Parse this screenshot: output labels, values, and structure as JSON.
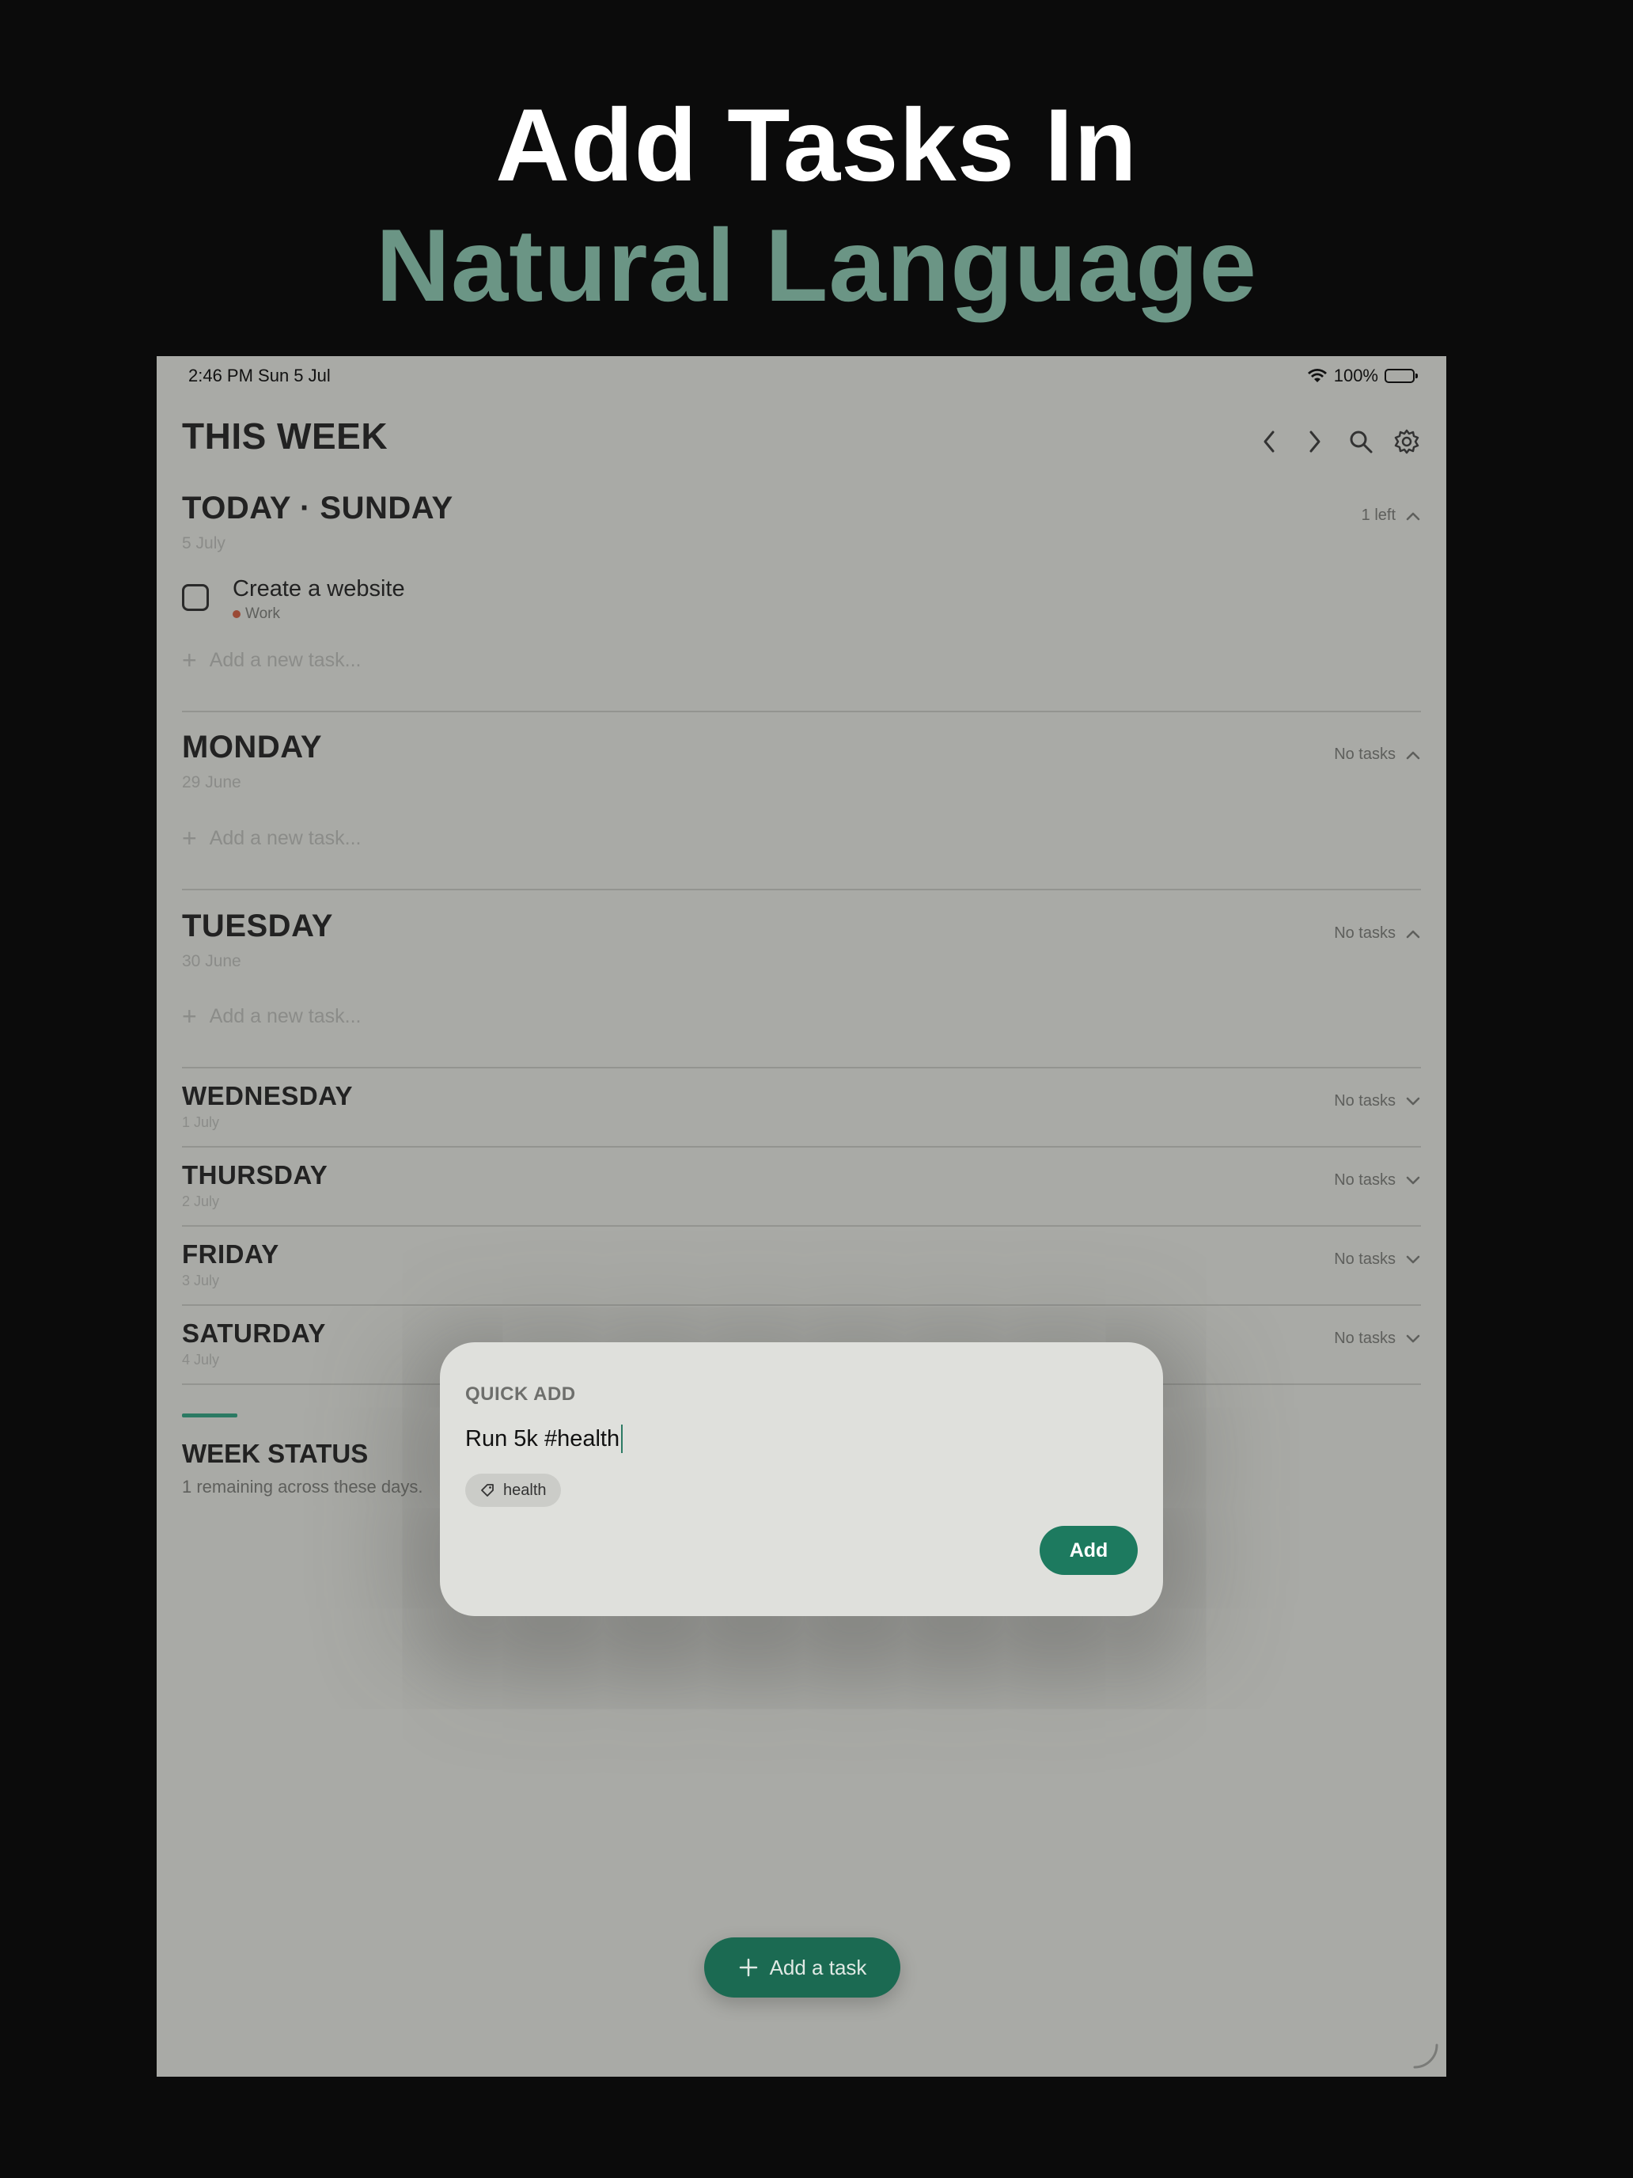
{
  "headline": {
    "line1": "Add Tasks In",
    "line2": "Natural Language"
  },
  "status_bar": {
    "time": "2:46 PM  Sun 5 Jul",
    "battery": "100%"
  },
  "header": {
    "title": "THIS WEEK"
  },
  "days": [
    {
      "name": "TODAY · SUNDAY",
      "date": "5 July",
      "meta": "1 left",
      "add_placeholder": "Add a new task..."
    },
    {
      "name": "MONDAY",
      "date": "29 June",
      "meta": "No tasks",
      "add_placeholder": "Add a new task..."
    },
    {
      "name": "TUESDAY",
      "date": "30 June",
      "meta": "No tasks",
      "add_placeholder": "Add a new task..."
    },
    {
      "name": "WEDNESDAY",
      "date": "1 July",
      "meta": "No tasks"
    },
    {
      "name": "THURSDAY",
      "date": "2 July",
      "meta": "No tasks"
    },
    {
      "name": "FRIDAY",
      "date": "3 July",
      "meta": "No tasks"
    },
    {
      "name": "SATURDAY",
      "date": "4 July",
      "meta": "No tasks"
    }
  ],
  "task": {
    "title": "Create a website",
    "tag": "Work",
    "tag_color": "#9a4a36"
  },
  "week_status": {
    "title": "WEEK STATUS",
    "subtitle": "1 remaining across these days."
  },
  "quick_add": {
    "label": "QUICK ADD",
    "input_value": "Run 5k #health",
    "chip": "health",
    "button": "Add"
  },
  "fab": {
    "label": "Add a task"
  },
  "colors": {
    "accent": "#1d7a5f",
    "headline_green": "#6b9585"
  }
}
